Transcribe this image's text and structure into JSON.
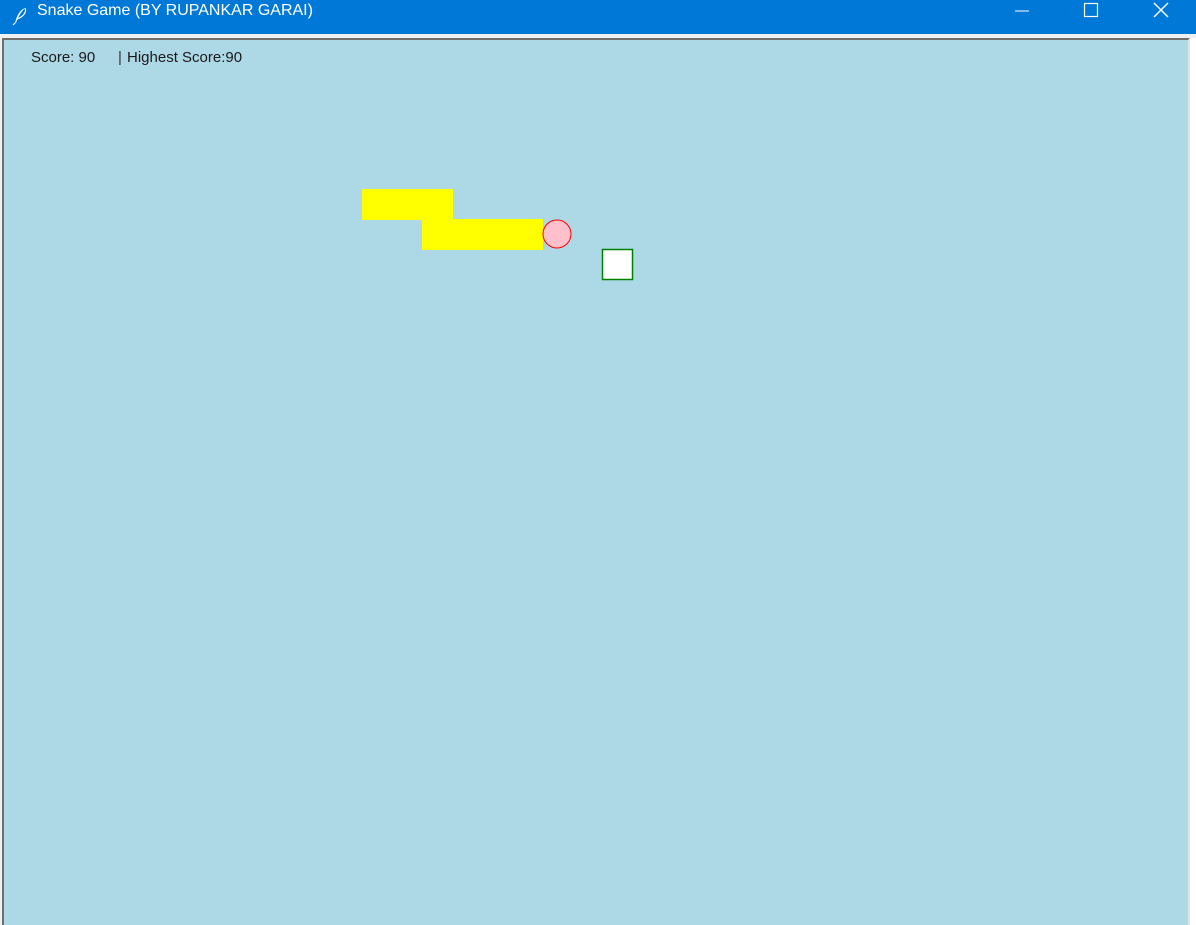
{
  "window": {
    "title": "Snake Game (BY RUPANKAR GARAI)",
    "icon": "feather-icon",
    "controls": [
      "minimize-icon",
      "maximize-icon",
      "close-icon"
    ]
  },
  "hud": {
    "score_text": "Score: 90",
    "separator": "|",
    "highest_text": "Highest Score:90"
  },
  "colors": {
    "titlebar": "#0078d7",
    "background": "#add8e6",
    "snake": "#ffff00",
    "snake_head": "#ffc0cb",
    "snake_head_outline": "#ff0000",
    "food": "#ffffff",
    "food_outline": "#008000"
  },
  "game": {
    "grid_unit": 30,
    "snake_body": [
      [
        12,
        5
      ],
      [
        13,
        5
      ],
      [
        14,
        5
      ],
      [
        14,
        6
      ],
      [
        15,
        6
      ],
      [
        16,
        6
      ],
      [
        17,
        6
      ]
    ],
    "snake_head": [
      18,
      6
    ],
    "food": [
      20,
      7
    ]
  }
}
